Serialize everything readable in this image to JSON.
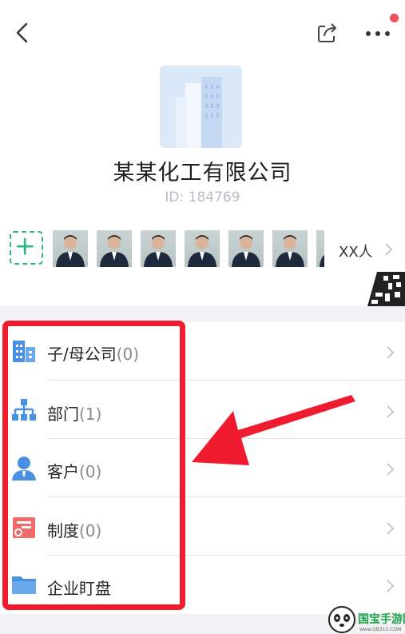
{
  "company": {
    "name": "某某化工有限公司",
    "id_text": "ID: 184769"
  },
  "members": {
    "count_text": "XX人",
    "avatar_count": 7
  },
  "menu": {
    "items": [
      {
        "label": "子/母公司",
        "count": "(0)",
        "icon": "org-building-icon"
      },
      {
        "label": "部门",
        "count": "(1)",
        "icon": "department-tree-icon"
      },
      {
        "label": "客户",
        "count": "(0)",
        "icon": "customer-person-icon"
      },
      {
        "label": "制度",
        "count": "(0)",
        "icon": "policy-document-icon"
      },
      {
        "label": "企业盯盘",
        "count": "",
        "icon": "folder-icon"
      }
    ]
  },
  "watermark": {
    "text": "国宝手游网",
    "subtext": "www.GB315.COM"
  },
  "colors": {
    "highlight": "#ee1c2e",
    "accent_green": "#2fb583",
    "icon_blue": "#4a90e2",
    "icon_red": "#f06a6a"
  }
}
